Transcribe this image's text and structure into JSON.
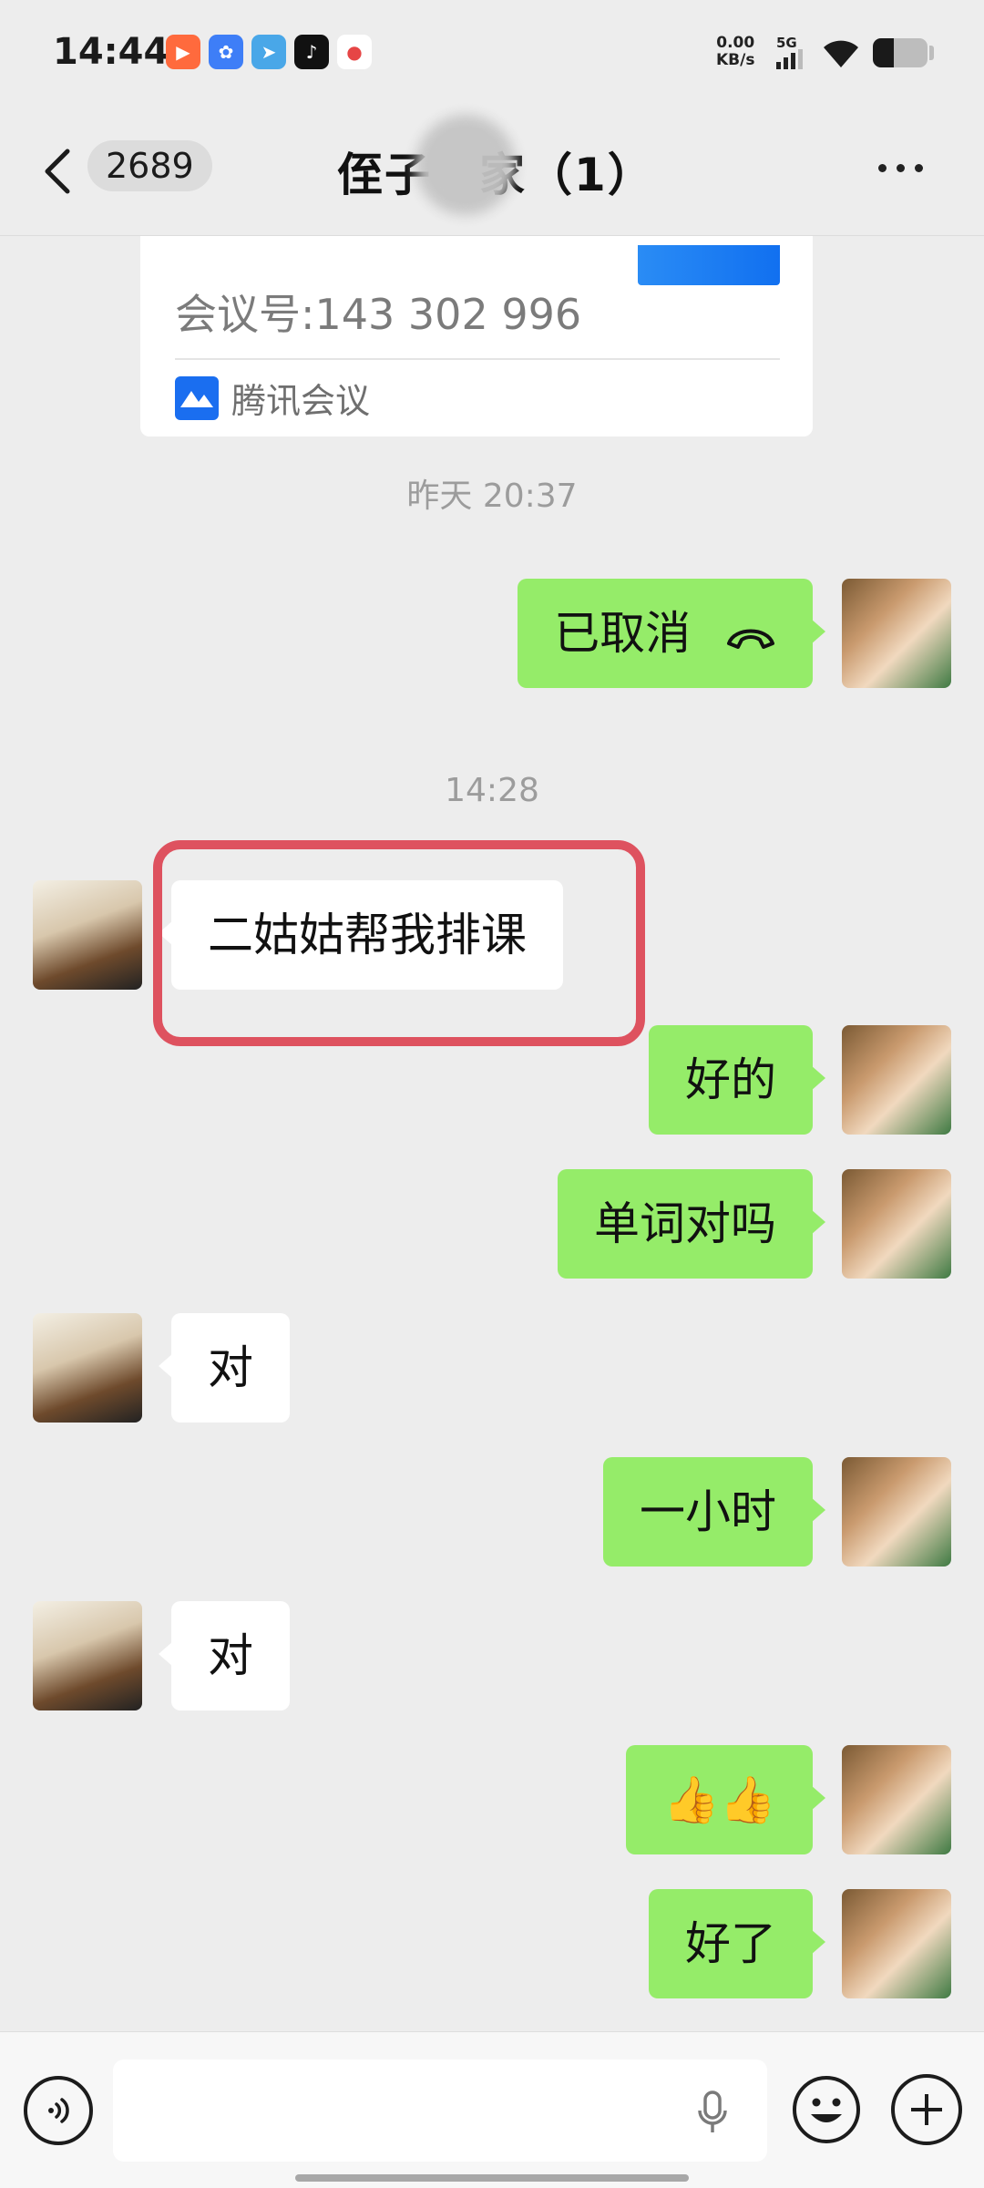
{
  "status_bar": {
    "time": "14:44",
    "net_speed_value": "0.00",
    "net_speed_unit": "KB/s",
    "network_type": "5G",
    "app_icons": [
      {
        "name": "kuaishou-icon",
        "color": "#ff6a3d",
        "glyph": "▶"
      },
      {
        "name": "baidu-icon",
        "color": "#3e7ef7",
        "glyph": "✿"
      },
      {
        "name": "telegram-icon",
        "color": "#49a7e8",
        "glyph": "➤"
      },
      {
        "name": "tiktok-icon",
        "color": "#111111",
        "glyph": "♪"
      },
      {
        "name": "map-pin-icon",
        "color": "#e64545",
        "glyph": "●"
      }
    ]
  },
  "nav": {
    "unread_count": "2689",
    "title": "侄子　家（1）"
  },
  "card": {
    "meeting_id": "会议号:143 302 996",
    "source": "腾讯会议"
  },
  "timestamps": {
    "yesterday": "昨天 20:37",
    "today": "14:28"
  },
  "messages": [
    {
      "side": "me",
      "text": "已取消"
    },
    {
      "side": "them",
      "text": "二姑姑帮我排课"
    },
    {
      "side": "me",
      "text": "好的"
    },
    {
      "side": "me",
      "text": "单词对吗"
    },
    {
      "side": "them",
      "text": "对"
    },
    {
      "side": "me",
      "text": "一小时"
    },
    {
      "side": "them",
      "text": "对"
    },
    {
      "side": "me",
      "text": "👍👍"
    },
    {
      "side": "me",
      "text": "好了"
    }
  ],
  "input": {
    "value": "",
    "placeholder": ""
  },
  "colors": {
    "my_bubble": "#95ec69",
    "their_bubble": "#ffffff",
    "highlight": "#de525f",
    "background": "#ededed"
  }
}
